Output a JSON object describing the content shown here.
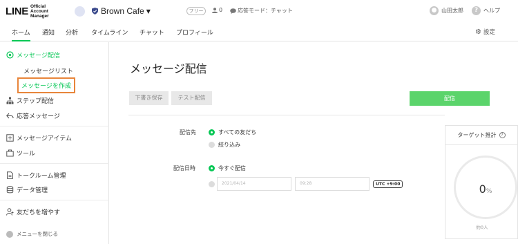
{
  "header": {
    "logo_text": "LINE",
    "logo_sub": "Official Account Manager",
    "account_name": "Brown Cafe",
    "plan_badge": "フリー",
    "friend_count": "0",
    "response_mode": "応答モード：チャット",
    "user_name": "山田太郎",
    "help_label": "ヘルプ"
  },
  "nav": {
    "tabs": [
      "ホーム",
      "通知",
      "分析",
      "タイムライン",
      "チャット",
      "プロフィール"
    ],
    "active_tab": "ホーム",
    "settings_label": "設定"
  },
  "sidebar": {
    "message_delivery": "メッセージ配信",
    "message_list": "メッセージリスト",
    "create_message": "メッセージを作成",
    "step_delivery": "ステップ配信",
    "auto_response": "応答メッセージ",
    "message_items": "メッセージアイテム",
    "tools": "ツール",
    "chatroom": "トークルーム管理",
    "data_management": "データ管理",
    "increase_friends": "友だちを増やす",
    "close_menu": "メニューを閉じる"
  },
  "main": {
    "title": "メッセージ配信",
    "save_draft": "下書き保存",
    "test_send": "テスト配信",
    "send": "配信",
    "recipient_label": "配信先",
    "recipient_all": "すべての友だち",
    "recipient_filter": "絞り込み",
    "datetime_label": "配信日時",
    "send_now": "今すぐ配信",
    "date_placeholder": "2021/04/14",
    "time_placeholder": "09:28",
    "timezone": "UTC +9:00"
  },
  "target": {
    "title": "ターゲット推計",
    "percent_value": "0",
    "percent_unit": "%",
    "count": "約0人"
  },
  "colors": {
    "brand_green": "#06c755",
    "send_button": "#5bd46b",
    "highlight_border": "#e8853a"
  }
}
